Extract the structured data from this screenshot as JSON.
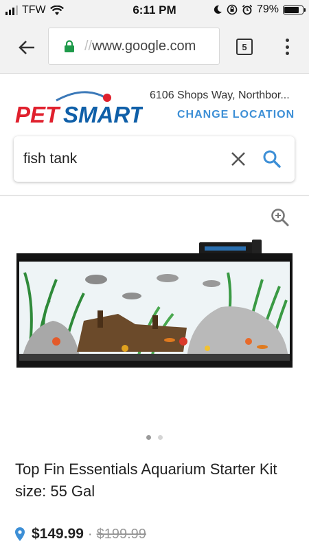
{
  "status_bar": {
    "carrier": "TFW",
    "time": "6:11 PM",
    "battery_percent": "79%",
    "battery_level": 0.79,
    "icons": [
      "signal-icon",
      "wifi-icon",
      "moon-icon",
      "rotation-lock-icon",
      "alarm-icon",
      "battery-icon"
    ]
  },
  "browser": {
    "url_faded": "//",
    "url": "www.google.com",
    "tab_count": "5",
    "icons": [
      "back-arrow-icon",
      "lock-icon",
      "menu-dots-icon"
    ]
  },
  "header": {
    "logo_text_left": "PET",
    "logo_text_right": "SMART",
    "store_address": "6106 Shops Way, Northbor...",
    "change_location_label": "CHANGE LOCATION"
  },
  "search": {
    "value": "fish tank",
    "icons": [
      "clear-icon",
      "search-icon"
    ]
  },
  "product": {
    "title": "Top Fin Essentials Aquarium Starter Kit size: 55 Gal",
    "price": "$149.99",
    "separator": "·",
    "original_price": "$199.99",
    "carousel_total": 2,
    "carousel_active": 1,
    "icons": [
      "zoom-in-icon",
      "location-pin-icon"
    ]
  },
  "colors": {
    "accent_blue": "#3d8fd6",
    "petsmart_red": "#e0202d",
    "petsmart_blue": "#0f5fa8",
    "secure_green": "#1e9a4a"
  }
}
